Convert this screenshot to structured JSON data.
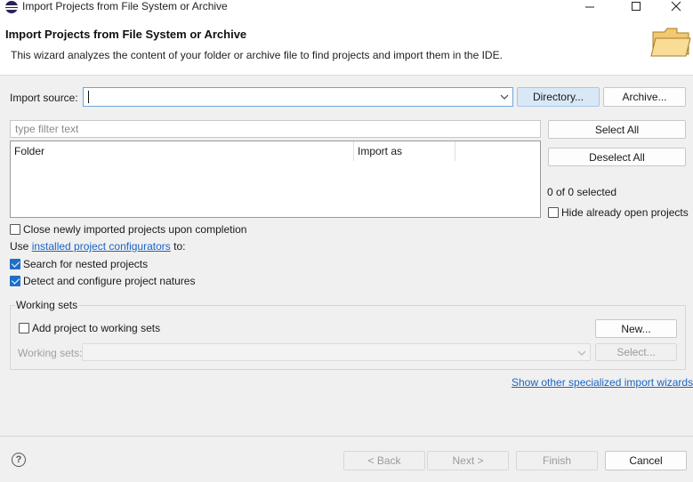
{
  "window": {
    "title": "Import Projects from File System or Archive",
    "controls": {
      "minimize": "minimize-icon",
      "maximize": "maximize-icon",
      "close": "close-icon"
    }
  },
  "header": {
    "title": "Import Projects from File System or Archive",
    "description": "This wizard analyzes the content of your folder or archive file to find projects and import them in the IDE."
  },
  "import_source": {
    "label": "Import source:",
    "value": "",
    "directory_button": "Directory...",
    "archive_button": "Archive..."
  },
  "filter": {
    "placeholder": "type filter text"
  },
  "table": {
    "columns": [
      "Folder",
      "Import as"
    ],
    "rows": []
  },
  "side": {
    "select_all": "Select All",
    "deselect_all": "Deselect All",
    "selection_count": "0 of 0 selected",
    "hide_open_label": "Hide already open projects"
  },
  "options": {
    "close_newly_label": "Close newly imported projects upon completion",
    "use_prefix": "Use ",
    "configurators_link": "installed project configurators",
    "use_suffix": " to:",
    "search_nested_label": "Search for nested projects",
    "detect_configure_label": "Detect and configure project natures"
  },
  "working_sets": {
    "group_title": "Working sets",
    "add_label": "Add project to working sets",
    "new_button": "New...",
    "sets_label": "Working sets:",
    "select_button": "Select..."
  },
  "link_specialized": "Show other specialized import wizards",
  "footer": {
    "back": "< Back",
    "next": "Next >",
    "finish": "Finish",
    "cancel": "Cancel"
  },
  "colors": {
    "accent": "#1f6fc7",
    "link": "#1c64c4",
    "focus_border": "#6ea6d9"
  }
}
